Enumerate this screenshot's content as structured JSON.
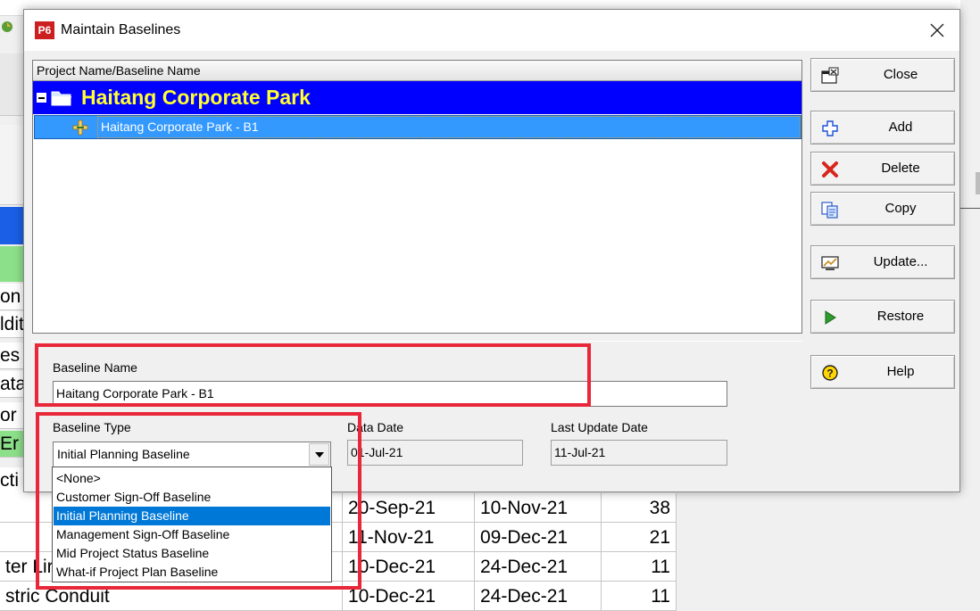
{
  "background": {
    "rows": [
      {
        "text": "on",
        "bg": "#ffffff"
      },
      {
        "text": "ldit",
        "bg": "#ffffff"
      },
      {
        "text": "es",
        "bg": "#ffffff"
      },
      {
        "text": "ata",
        "bg": "#ffffff"
      },
      {
        "text": "or",
        "bg": "#ffffff"
      },
      {
        "text": "Er",
        "bg": "#8de08a"
      },
      {
        "text": "cti",
        "bg": "#ffffff"
      }
    ],
    "table": [
      {
        "name": "",
        "start": "20-Sep-21",
        "finish": "10-Nov-21",
        "dur": "38"
      },
      {
        "name": "",
        "start": "11-Nov-21",
        "finish": "09-Dec-21",
        "dur": "21"
      },
      {
        "name": "ter Lir",
        "start": "10-Dec-21",
        "finish": "24-Dec-21",
        "dur": "11"
      },
      {
        "name": "stric Conduit",
        "start": "10-Dec-21",
        "finish": "24-Dec-21",
        "dur": "11"
      }
    ]
  },
  "dialog": {
    "logo": "P6",
    "title": "Maintain Baselines",
    "list_header": "Project Name/Baseline Name",
    "project_name": "Haitang Corporate Park",
    "baseline_item": "Haitang Corporate Park - B1",
    "baseline_name_label": "Baseline Name",
    "baseline_name_value": "Haitang Corporate Park - B1",
    "baseline_type_label": "Baseline Type",
    "baseline_type_value": "Initial Planning Baseline",
    "data_date_label": "Data Date",
    "data_date_value": "01-Jul-21",
    "last_update_label": "Last Update Date",
    "last_update_value": "11-Jul-21",
    "buttons": {
      "close": "Close",
      "add": "Add",
      "delete": "Delete",
      "copy": "Copy",
      "update": "Update...",
      "restore": "Restore",
      "help": "Help"
    },
    "type_options": [
      "<None>",
      "Customer Sign-Off Baseline",
      "Initial Planning Baseline",
      "Management Sign-Off Baseline",
      "Mid Project Status Baseline",
      "What-if Project Plan Baseline"
    ],
    "selected_option_index": 2
  },
  "colors": {
    "project_row": "#0000ff",
    "project_text": "#ffff33",
    "selection": "#3399ff",
    "highlight": "#e8283a"
  }
}
